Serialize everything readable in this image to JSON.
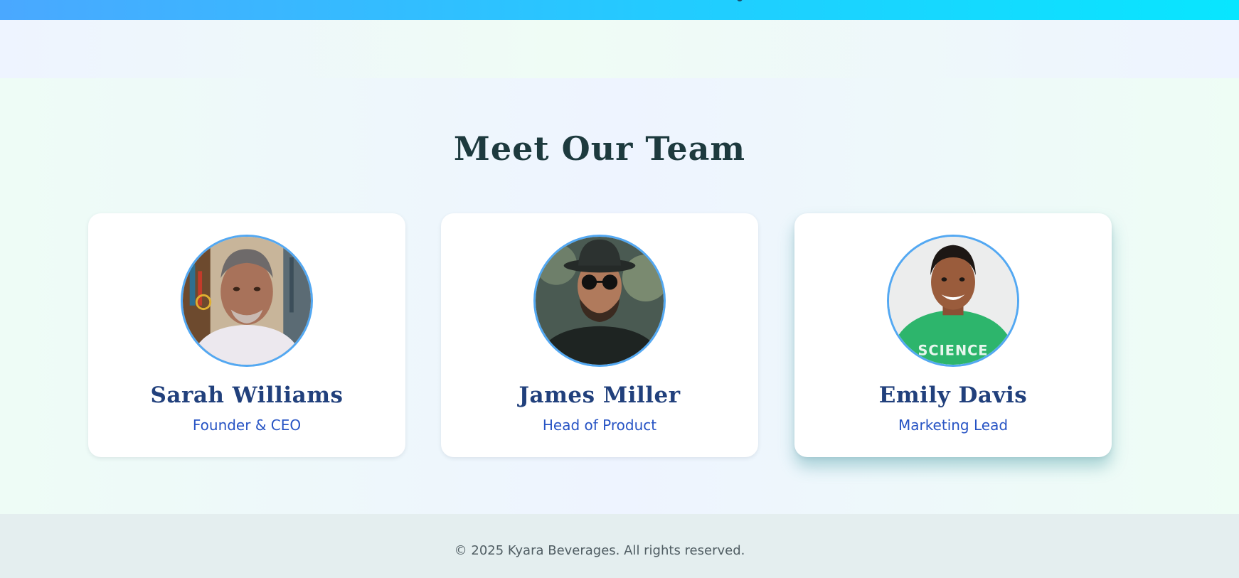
{
  "header": {
    "accent_start": "#4aa8ff",
    "accent_end": "#08e6ff"
  },
  "team": {
    "title": "Meet Our Team",
    "members": [
      {
        "name": "Sarah Williams",
        "role": "Founder & CEO",
        "photo_icon": "portrait-photo"
      },
      {
        "name": "James Miller",
        "role": "Head of Product",
        "photo_icon": "portrait-photo"
      },
      {
        "name": "Emily Davis",
        "role": "Marketing Lead",
        "photo_icon": "portrait-photo",
        "shirt_text": "SCIENCE"
      }
    ]
  },
  "footer": {
    "copyright": "© 2025 Kyara Beverages. All rights reserved."
  },
  "colors": {
    "heading": "#1d3a3e",
    "name": "#21407c",
    "role": "#2653c4",
    "avatar_border": "#53a8f2"
  }
}
